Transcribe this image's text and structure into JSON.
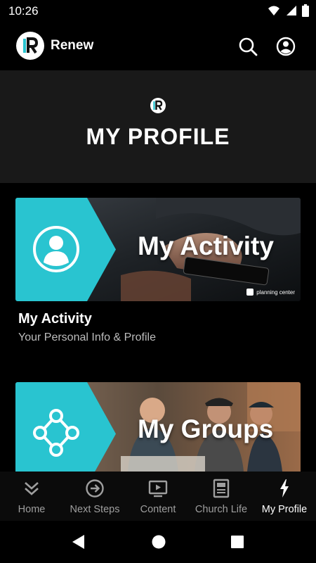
{
  "status_bar": {
    "time": "10:26"
  },
  "app_bar": {
    "title": "Renew"
  },
  "hero": {
    "title": "MY PROFILE"
  },
  "cards": [
    {
      "overlay_title": "My Activity",
      "title": "My Activity",
      "subtitle": "Your Personal Info & Profile",
      "badge_text": "planning center",
      "icon": "person-icon"
    },
    {
      "overlay_title": "My Groups",
      "title": "My Groups",
      "icon": "network-icon"
    }
  ],
  "bottom_nav": {
    "items": [
      {
        "label": "Home",
        "icon": "double-chevron-down-icon",
        "active": false
      },
      {
        "label": "Next Steps",
        "icon": "arrow-circle-icon",
        "active": false
      },
      {
        "label": "Content",
        "icon": "tv-play-icon",
        "active": false
      },
      {
        "label": "Church Life",
        "icon": "newspaper-icon",
        "active": false
      },
      {
        "label": "My Profile",
        "icon": "lightning-icon",
        "active": true
      }
    ]
  },
  "colors": {
    "accent": "#29c4d0",
    "background": "#000000",
    "hero": "#191919"
  }
}
